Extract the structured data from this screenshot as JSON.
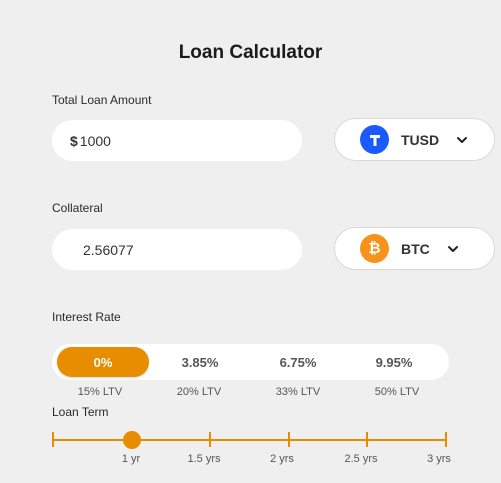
{
  "title": "Loan Calculator",
  "loan_amount": {
    "label": "Total Loan Amount",
    "currency_symbol": "$",
    "value": "1000",
    "asset": {
      "symbol": "TUSD",
      "icon": "tusd-icon",
      "color": "#1a5aff"
    }
  },
  "collateral": {
    "label": "Collateral",
    "value": "2.56077",
    "asset": {
      "symbol": "BTC",
      "icon": "bitcoin-icon",
      "color": "#f7931a"
    }
  },
  "interest": {
    "label": "Interest Rate",
    "selected_index": 0,
    "options": [
      {
        "rate": "0%",
        "ltv": "15% LTV"
      },
      {
        "rate": "3.85%",
        "ltv": "20% LTV"
      },
      {
        "rate": "6.75%",
        "ltv": "33% LTV"
      },
      {
        "rate": "9.95%",
        "ltv": "50% LTV"
      }
    ]
  },
  "loan_term": {
    "label": "Loan Term",
    "selected_index": 1,
    "options": [
      "",
      "1 yr",
      "1.5 yrs",
      "2 yrs",
      "2.5 yrs",
      "3 yrs"
    ]
  },
  "accent_color": "#e88c00"
}
